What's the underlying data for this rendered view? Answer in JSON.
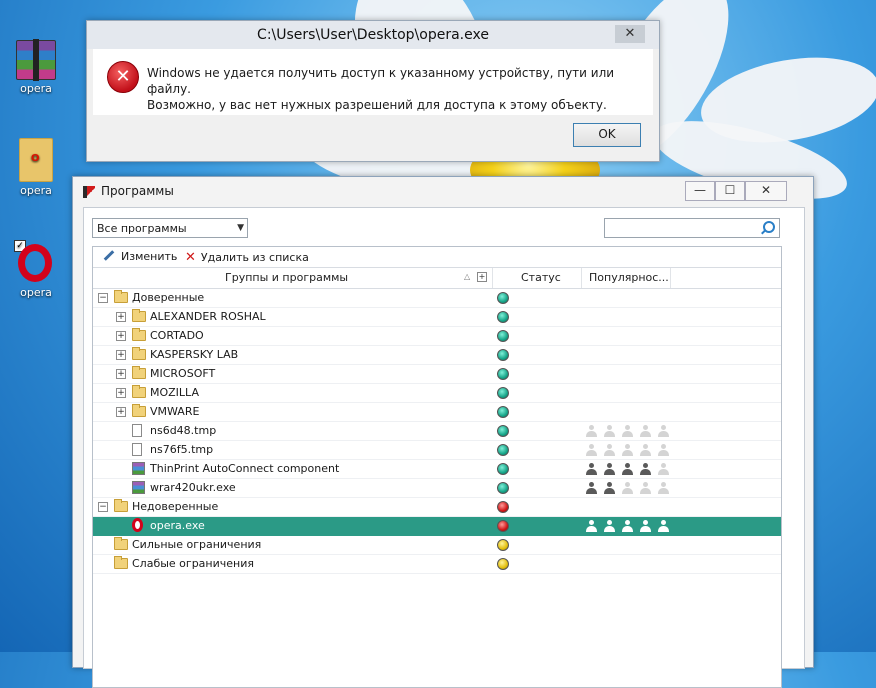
{
  "desktop": {
    "icons": [
      {
        "label": "opera",
        "icon": "winrar-archive-icon"
      },
      {
        "label": "opera",
        "icon": "folder-icon"
      },
      {
        "label": "opera",
        "icon": "opera-logo-icon"
      }
    ]
  },
  "error_dialog": {
    "title": "C:\\Users\\User\\Desktop\\opera.exe",
    "close_label": "✕",
    "message_line1": "Windows не удается получить доступ к указанному устройству, пути или файлу.",
    "message_line2": "Возможно, у вас нет нужных разрешений для доступа к этому объекту.",
    "ok_label": "OK"
  },
  "programs_window": {
    "title": "Программы",
    "minimize_label": "—",
    "maximize_label": "☐",
    "close_label": "✕",
    "filter": {
      "selected": "Все программы"
    },
    "search": {
      "placeholder": ""
    },
    "toolbar": {
      "edit_label": "Изменить",
      "remove_label": "Удалить из списка"
    },
    "columns": {
      "name": "Группы и программы",
      "status": "Статус",
      "popularity": "Популярнос..."
    },
    "rows": [
      {
        "label": "Доверенные",
        "kind": "group",
        "level": 0,
        "expander": "−",
        "status": "green",
        "popularity": null
      },
      {
        "label": "ALEXANDER ROSHAL",
        "kind": "vendor",
        "level": 1,
        "expander": "+",
        "status": "green",
        "popularity": null
      },
      {
        "label": "CORTADO",
        "kind": "vendor",
        "level": 1,
        "expander": "+",
        "status": "green",
        "popularity": null
      },
      {
        "label": "KASPERSKY LAB",
        "kind": "vendor",
        "level": 1,
        "expander": "+",
        "status": "green",
        "popularity": null
      },
      {
        "label": "MICROSOFT",
        "kind": "vendor",
        "level": 1,
        "expander": "+",
        "status": "green",
        "popularity": null
      },
      {
        "label": "MOZILLA",
        "kind": "vendor",
        "level": 1,
        "expander": "+",
        "status": "green",
        "popularity": null
      },
      {
        "label": "VMWARE",
        "kind": "vendor",
        "level": 1,
        "expander": "+",
        "status": "green",
        "popularity": null
      },
      {
        "label": "ns6d48.tmp",
        "kind": "file",
        "level": 1,
        "expander": null,
        "status": "green",
        "popularity": 0
      },
      {
        "label": "ns76f5.tmp",
        "kind": "file",
        "level": 1,
        "expander": null,
        "status": "green",
        "popularity": 0
      },
      {
        "label": "ThinPrint AutoConnect component",
        "kind": "app",
        "level": 1,
        "expander": null,
        "status": "green",
        "popularity": 4
      },
      {
        "label": "wrar420ukr.exe",
        "kind": "app",
        "level": 1,
        "expander": null,
        "status": "green",
        "popularity": 2
      },
      {
        "label": "Недоверенные",
        "kind": "group",
        "level": 0,
        "expander": "−",
        "status": "red",
        "popularity": null
      },
      {
        "label": "opera.exe",
        "kind": "opera",
        "level": 1,
        "expander": null,
        "status": "red",
        "popularity": 5,
        "selected": true
      },
      {
        "label": "Сильные ограничения",
        "kind": "group",
        "level": 0,
        "expander": null,
        "status": "yellow",
        "popularity": null
      },
      {
        "label": "Слабые ограничения",
        "kind": "group",
        "level": 0,
        "expander": null,
        "status": "yellow",
        "popularity": null
      }
    ]
  },
  "colors": {
    "selection": "#2b9a86",
    "status_green": "#17a589",
    "status_red": "#d01818",
    "status_yellow": "#e3bf0e"
  }
}
